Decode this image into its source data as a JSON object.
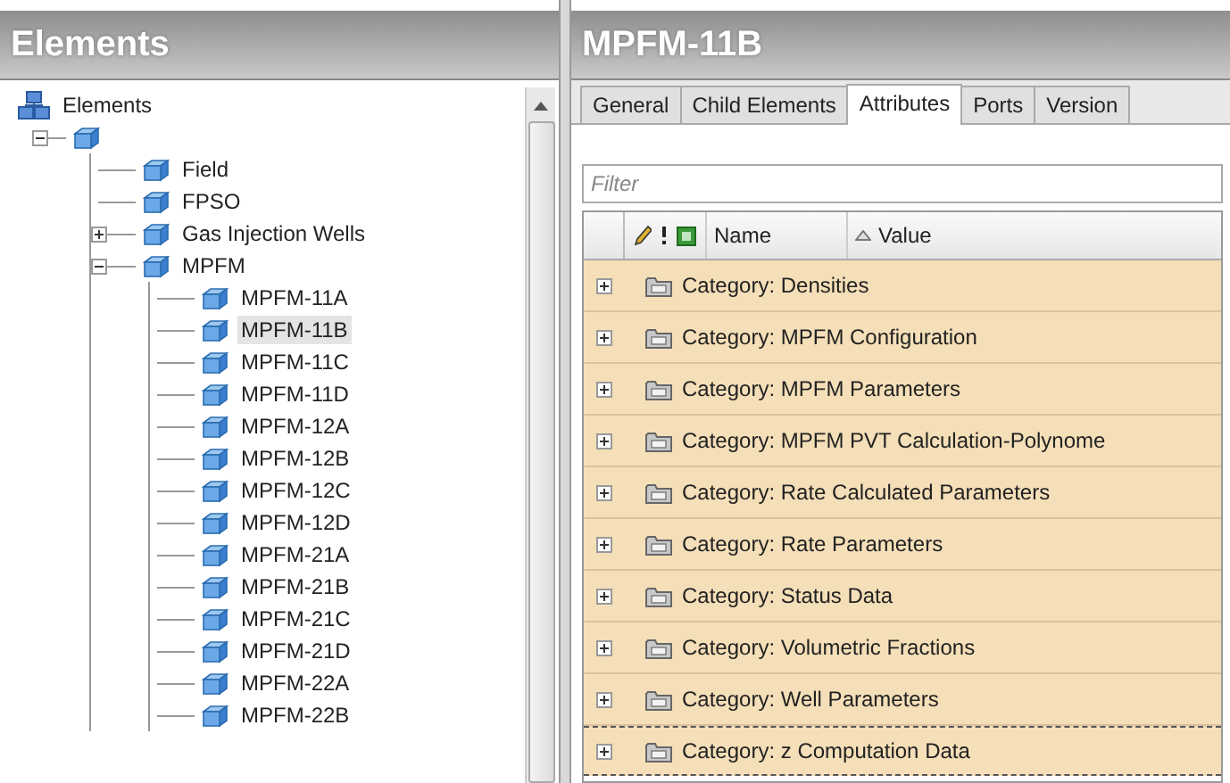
{
  "left_panel": {
    "title": "Elements",
    "tree": [
      {
        "label": "Elements",
        "kind": "root",
        "selected": false,
        "children": [
          {
            "expanded": true,
            "children": [
              {
                "label": "Field",
                "selected": false
              },
              {
                "label": "FPSO",
                "selected": false
              },
              {
                "label": "Gas Injection Wells",
                "expanded": false,
                "selected": false
              },
              {
                "label": "MPFM",
                "expanded": true,
                "selected": false,
                "children": [
                  {
                    "label": "MPFM-11A",
                    "selected": false
                  },
                  {
                    "label": "MPFM-11B",
                    "selected": true
                  },
                  {
                    "label": "MPFM-11C",
                    "selected": false
                  },
                  {
                    "label": "MPFM-11D",
                    "selected": false
                  },
                  {
                    "label": "MPFM-12A",
                    "selected": false
                  },
                  {
                    "label": "MPFM-12B",
                    "selected": false
                  },
                  {
                    "label": "MPFM-12C",
                    "selected": false
                  },
                  {
                    "label": "MPFM-12D",
                    "selected": false
                  },
                  {
                    "label": "MPFM-21A",
                    "selected": false
                  },
                  {
                    "label": "MPFM-21B",
                    "selected": false
                  },
                  {
                    "label": "MPFM-21C",
                    "selected": false
                  },
                  {
                    "label": "MPFM-21D",
                    "selected": false
                  },
                  {
                    "label": "MPFM-22A",
                    "selected": false
                  },
                  {
                    "label": "MPFM-22B",
                    "selected": false
                  }
                ]
              }
            ]
          }
        ]
      }
    ]
  },
  "right_panel": {
    "title": "MPFM-11B",
    "tabs": [
      {
        "label": "General",
        "selected": false
      },
      {
        "label": "Child Elements",
        "selected": false
      },
      {
        "label": "Attributes",
        "selected": true
      },
      {
        "label": "Ports",
        "selected": false
      },
      {
        "label": "Version",
        "selected": false
      }
    ],
    "filter": {
      "placeholder": "Filter"
    },
    "grid": {
      "columns": [
        {
          "label": "Name",
          "sorted_ascending": false
        },
        {
          "label": "Value",
          "sorted_ascending": true
        }
      ],
      "rows": [
        {
          "label": "Category: Densities",
          "expanded": false,
          "focused": false
        },
        {
          "label": "Category: MPFM Configuration",
          "expanded": false,
          "focused": false
        },
        {
          "label": "Category: MPFM Parameters",
          "expanded": false,
          "focused": false
        },
        {
          "label": "Category: MPFM PVT Calculation-Polynome",
          "expanded": false,
          "focused": false
        },
        {
          "label": "Category: Rate Calculated Parameters",
          "expanded": false,
          "focused": false
        },
        {
          "label": "Category: Rate Parameters",
          "expanded": false,
          "focused": false
        },
        {
          "label": "Category: Status Data",
          "expanded": false,
          "focused": false
        },
        {
          "label": "Category: Volumetric Fractions",
          "expanded": false,
          "focused": false
        },
        {
          "label": "Category: Well Parameters",
          "expanded": false,
          "focused": false
        },
        {
          "label": "Category: z Computation Data",
          "expanded": false,
          "focused": true
        }
      ]
    }
  }
}
